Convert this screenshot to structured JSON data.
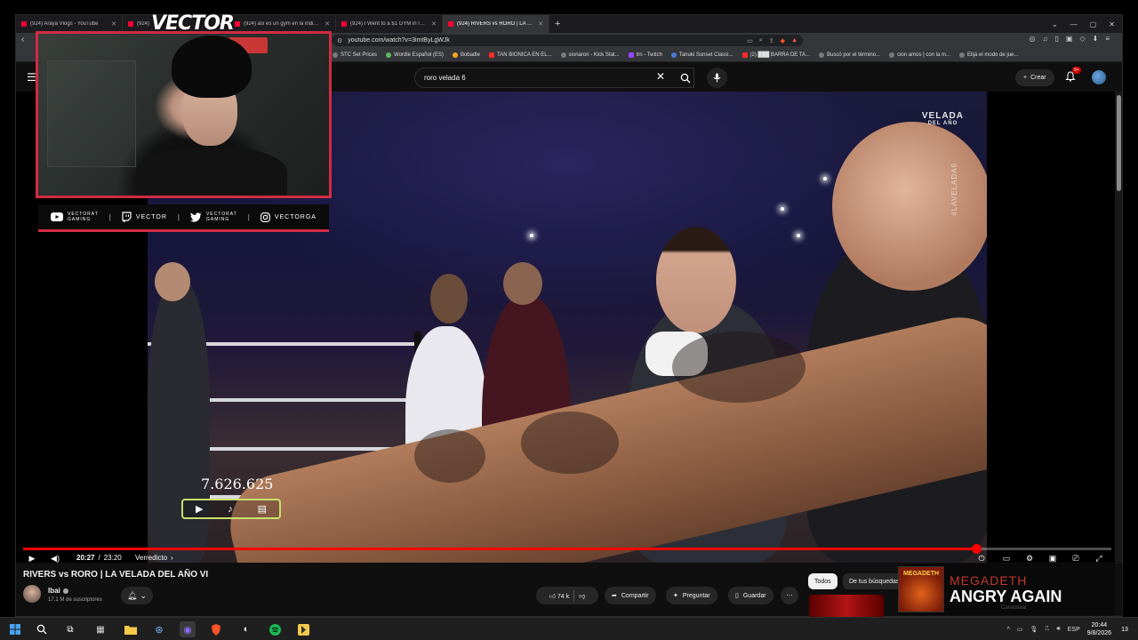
{
  "browser": {
    "tabs": [
      {
        "label": "(924) Araya Vlogs - YouTube",
        "active": false
      },
      {
        "label": "(924)",
        "active": false
      },
      {
        "label": "(924) asi es un gym en la india - You",
        "active": false
      },
      {
        "label": "(924) I Went to a $1 GYM in India - Y",
        "active": false
      },
      {
        "label": "(924) RIVERS vs RORO | LA VELA",
        "active": true
      }
    ],
    "url": "youtube.com/watch?v=3imtByLgWJk",
    "bookmarks": [
      {
        "label": "STC Set Prices",
        "color": "gray"
      },
      {
        "label": "Wordle Español (ES)",
        "color": "green"
      },
      {
        "label": "Bobadle",
        "color": "orange"
      },
      {
        "label": "TAN BIONICA EN EL...",
        "color": "red"
      },
      {
        "label": "sionaron - Kick Stat...",
        "color": "gray"
      },
      {
        "label": "trn - Twitch",
        "color": "purple"
      },
      {
        "label": "Tanuki Sunset Classi...",
        "color": "blue"
      },
      {
        "label": "(2) ███ BARRA DE TA...",
        "color": "red"
      },
      {
        "label": "Buscó por el término...",
        "color": "gray"
      },
      {
        "label": "cion amos | con la m...",
        "color": "gray"
      },
      {
        "label": "Elijá el modo de jue...",
        "color": "gray"
      }
    ]
  },
  "youtube": {
    "search_value": "roro velada 6",
    "create_label": "Crear",
    "notif_count": "9+",
    "video": {
      "current_time": "20:27",
      "duration": "23:20",
      "time_sep": " / ",
      "chapter": "Verredicto",
      "progress": 0.876,
      "overlay_counter": "7.626.625",
      "logo_text": "VELADA",
      "logo_sub": "DEL AÑO",
      "vertical_tag": "#LAVELADA6"
    },
    "title": "RIVERS vs RORO | LA VELADA DEL AÑO VI",
    "channel": {
      "name": "Ibai",
      "subscribers": "17.1 M de suscriptores"
    },
    "actions": {
      "likes": "74 k",
      "share": "Compartir",
      "ask": "Preguntar",
      "save": "Guardar"
    },
    "chips": [
      "Todos",
      "De tus búsquedas"
    ],
    "side_channel": "Canalalaal"
  },
  "overlay": {
    "brand": "VECTOR",
    "socials": [
      {
        "icon": "youtube-icon",
        "top": "VECTORAT",
        "bottom": "GAMING"
      },
      {
        "icon": "twitch-icon",
        "top": "VECTOR",
        "bottom": ""
      },
      {
        "icon": "twitter-icon",
        "top": "VECTORAT",
        "bottom": "GAMING"
      },
      {
        "icon": "instagram-icon",
        "top": "VECTORGA",
        "bottom": ""
      }
    ],
    "now_playing": {
      "artist": "MEGADETH",
      "song": "ANGRY AGAIN",
      "album_text": "MEGADETH"
    }
  },
  "taskbar": {
    "lang": "ESP",
    "time": "20:44",
    "date": "9/8/2026",
    "notif": "13"
  },
  "colors": {
    "accent": "#d12b44",
    "progress": "#ff0000",
    "yt_bg": "#0f0f0f"
  }
}
